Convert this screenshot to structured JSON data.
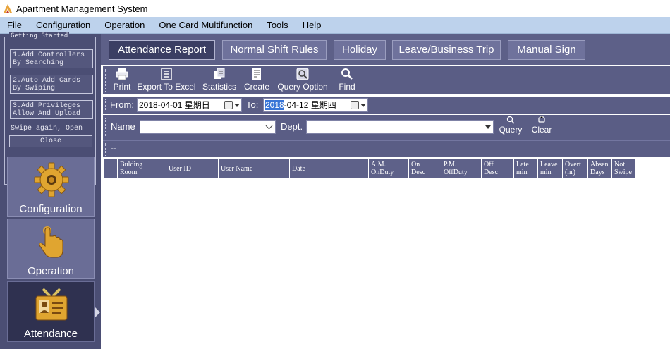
{
  "window": {
    "title": "Apartment Management System"
  },
  "menu": [
    "File",
    "Configuration",
    "Operation",
    "One Card Multifunction",
    "Tools",
    "Help"
  ],
  "getting_started": {
    "title": "Getting Started",
    "steps": [
      "1.Add Controllers\nBy Searching",
      "2.Auto Add Cards\nBy Swiping",
      "3.Add Privileges\nAllow And Upload"
    ],
    "swipe_text": "Swipe again, Open",
    "close_label": "Close"
  },
  "modules": [
    {
      "label": "Configuration",
      "icon": "gear-icon"
    },
    {
      "label": "Operation",
      "icon": "hand-pointer-icon"
    },
    {
      "label": "Attendance",
      "icon": "id-badge-icon",
      "active": true
    }
  ],
  "tabs": [
    {
      "label": "Attendance Report",
      "active": true
    },
    {
      "label": "Normal Shift Rules"
    },
    {
      "label": "Holiday"
    },
    {
      "label": "Leave/Business Trip"
    },
    {
      "label": "Manual Sign"
    }
  ],
  "toolbar": [
    {
      "label": "Print",
      "icon": "printer-icon"
    },
    {
      "label": "Export To Excel",
      "icon": "excel-icon"
    },
    {
      "label": "Statistics",
      "icon": "statistics-icon"
    },
    {
      "label": "Create",
      "icon": "create-icon"
    },
    {
      "label": "Query Option",
      "icon": "query-option-icon"
    },
    {
      "label": "Find",
      "icon": "find-icon"
    }
  ],
  "date_range": {
    "from_label": "From:",
    "from_value": "2018-04-01 星期日",
    "to_label": "To:",
    "to_selected": "2018",
    "to_rest": "-04-12 星期四"
  },
  "filters": {
    "name_label": "Name",
    "name_value": "",
    "dept_label": "Dept.",
    "dept_value": "",
    "query_label": "Query",
    "clear_label": "Clear"
  },
  "status_text": "--",
  "grid_columns": [
    "Bulding\nRoom",
    "User ID",
    "User Name",
    "Date",
    "A.M.\nOnDuty",
    "On\nDesc",
    "P.M.\nOffDuty",
    "Off\nDesc",
    "Late\nmin",
    "Leave\nmin",
    "Overt\n(hr)",
    "Absen\nDays",
    "Not\nSwipe"
  ],
  "colors": {
    "sidebar_bg": "#4b4e74",
    "toolbar_bg": "#5a5d85",
    "menubar_bg": "#bdd2ec",
    "active_module_bg": "#2f3150",
    "selection": "#3875d7"
  }
}
